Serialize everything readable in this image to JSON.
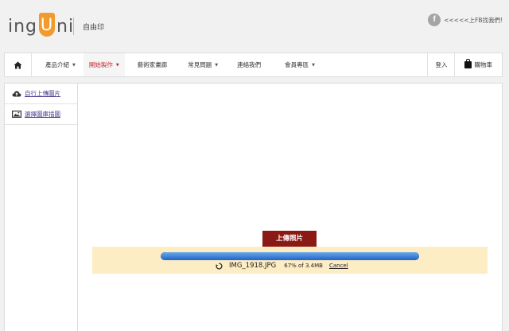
{
  "header": {
    "logo_pre": "ing",
    "logo_u": "U",
    "logo_post": "ni",
    "tagline": "自由印",
    "fb_link": "<<<<<上FB找我們!"
  },
  "nav": {
    "items": [
      {
        "label": "產品介紹",
        "caret": "▼"
      },
      {
        "label": "開始製作",
        "caret": "▼"
      },
      {
        "label": "藝術家畫廊"
      },
      {
        "label": "常見問題",
        "caret": "▼"
      },
      {
        "label": "連絡我們"
      },
      {
        "label": "會員專區",
        "caret": "▼"
      }
    ],
    "login": "登入",
    "cart": "購物車"
  },
  "sidebar": {
    "items": [
      {
        "label": "自行上傳圖片",
        "icon": "cloud-upload-icon"
      },
      {
        "label": "選擇圖庫插圖",
        "icon": "image-icon"
      }
    ]
  },
  "upload": {
    "button_label": "上傳照片",
    "filename": "IMG_1918.JPG",
    "progress_text": "67% of 3.4MB",
    "progress_fraction": 0.67,
    "cancel_label": "Cancel"
  },
  "colors": {
    "brand_orange": "#f39a2d",
    "accent_red": "#c0272d",
    "button_dark_red": "#8b1a14",
    "progress_blue": "#1f64c7",
    "panel_yellow": "#fdedc4"
  }
}
